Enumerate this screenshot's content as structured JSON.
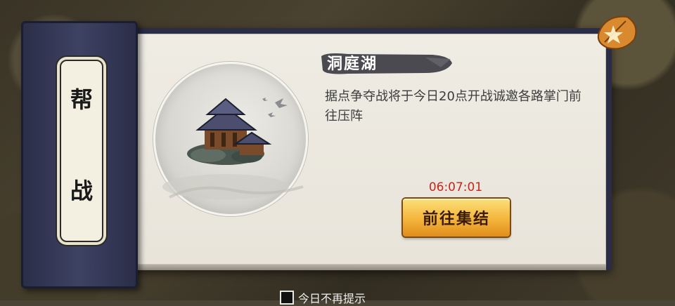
{
  "banner": {
    "char_top": "帮",
    "char_bottom": "战"
  },
  "event": {
    "location_title": "洞庭湖",
    "description": "据点争夺战将于今日20点开战诚邀各路掌门前往压阵",
    "countdown": "06:07:01",
    "action_label": "前往集结"
  },
  "footer": {
    "checkbox_label": "今日不再提示"
  },
  "colors": {
    "banner": "#2b2e48",
    "timer": "#c5261d",
    "button_gold": "#f4b53b"
  },
  "icons": {
    "corner": "leaf-emblem-icon",
    "medallion": "pavilion-illustration"
  }
}
